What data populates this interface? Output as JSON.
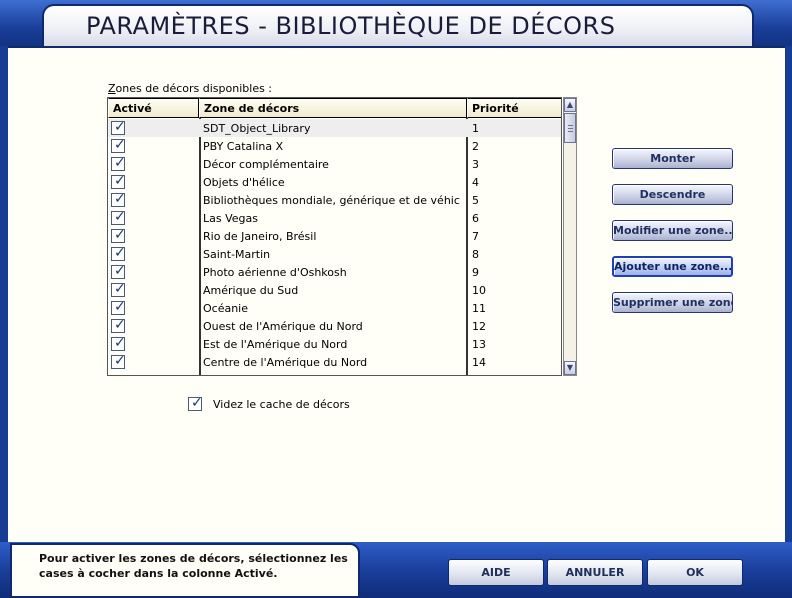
{
  "window": {
    "title": "PARAMÈTRES - BIBLIOTHÈQUE DE DÉCORS"
  },
  "zones": {
    "label_accel": "Z",
    "label_rest": "ones de décors disponibles :",
    "columns": {
      "active": "Activé",
      "zone": "Zone de décors",
      "priority": "Priorité"
    },
    "rows": [
      {
        "name": "SDT_Object_Library",
        "priority": "1",
        "checked": true
      },
      {
        "name": "PBY Catalina X",
        "priority": "2",
        "checked": true
      },
      {
        "name": "Décor complémentaire",
        "priority": "3",
        "checked": true
      },
      {
        "name": "Objets d'hélice",
        "priority": "4",
        "checked": true
      },
      {
        "name": "Bibliothèques mondiale, générique et de véhic",
        "priority": "5",
        "checked": true
      },
      {
        "name": "Las Vegas",
        "priority": "6",
        "checked": true
      },
      {
        "name": "Rio de Janeiro, Brésil",
        "priority": "7",
        "checked": true
      },
      {
        "name": "Saint-Martin",
        "priority": "8",
        "checked": true
      },
      {
        "name": "Photo aérienne d'Oshkosh",
        "priority": "9",
        "checked": true
      },
      {
        "name": "Amérique du Sud",
        "priority": "10",
        "checked": true
      },
      {
        "name": "Océanie",
        "priority": "11",
        "checked": true
      },
      {
        "name": "Ouest de l'Amérique du Nord",
        "priority": "12",
        "checked": true
      },
      {
        "name": "Est de l'Amérique du Nord",
        "priority": "13",
        "checked": true
      },
      {
        "name": "Centre de l'Amérique du Nord",
        "priority": "14",
        "checked": true
      }
    ]
  },
  "buttons": {
    "move_up": "Monter",
    "move_down": "Descendre",
    "edit_zone": "Modifier une zone...",
    "add_zone": "Ajouter une zone...",
    "delete_zone": "Supprimer une zone"
  },
  "cache": {
    "label": "Videz le cache de décors",
    "checked": true
  },
  "hint": {
    "text": "Pour activer les zones de décors, sélectionnez les cases à cocher dans la colonne Activé."
  },
  "footer": {
    "help": "AIDE",
    "cancel": "ANNULER",
    "ok": "OK"
  },
  "icons": {
    "checkmark": "checkmark-icon",
    "scroll_up": "scroll-up-icon",
    "scroll_down": "scroll-down-icon"
  },
  "colors": {
    "frame": "#1c3f8c",
    "panel": "#fffff8",
    "active_button_border": "#1f3fb8"
  }
}
